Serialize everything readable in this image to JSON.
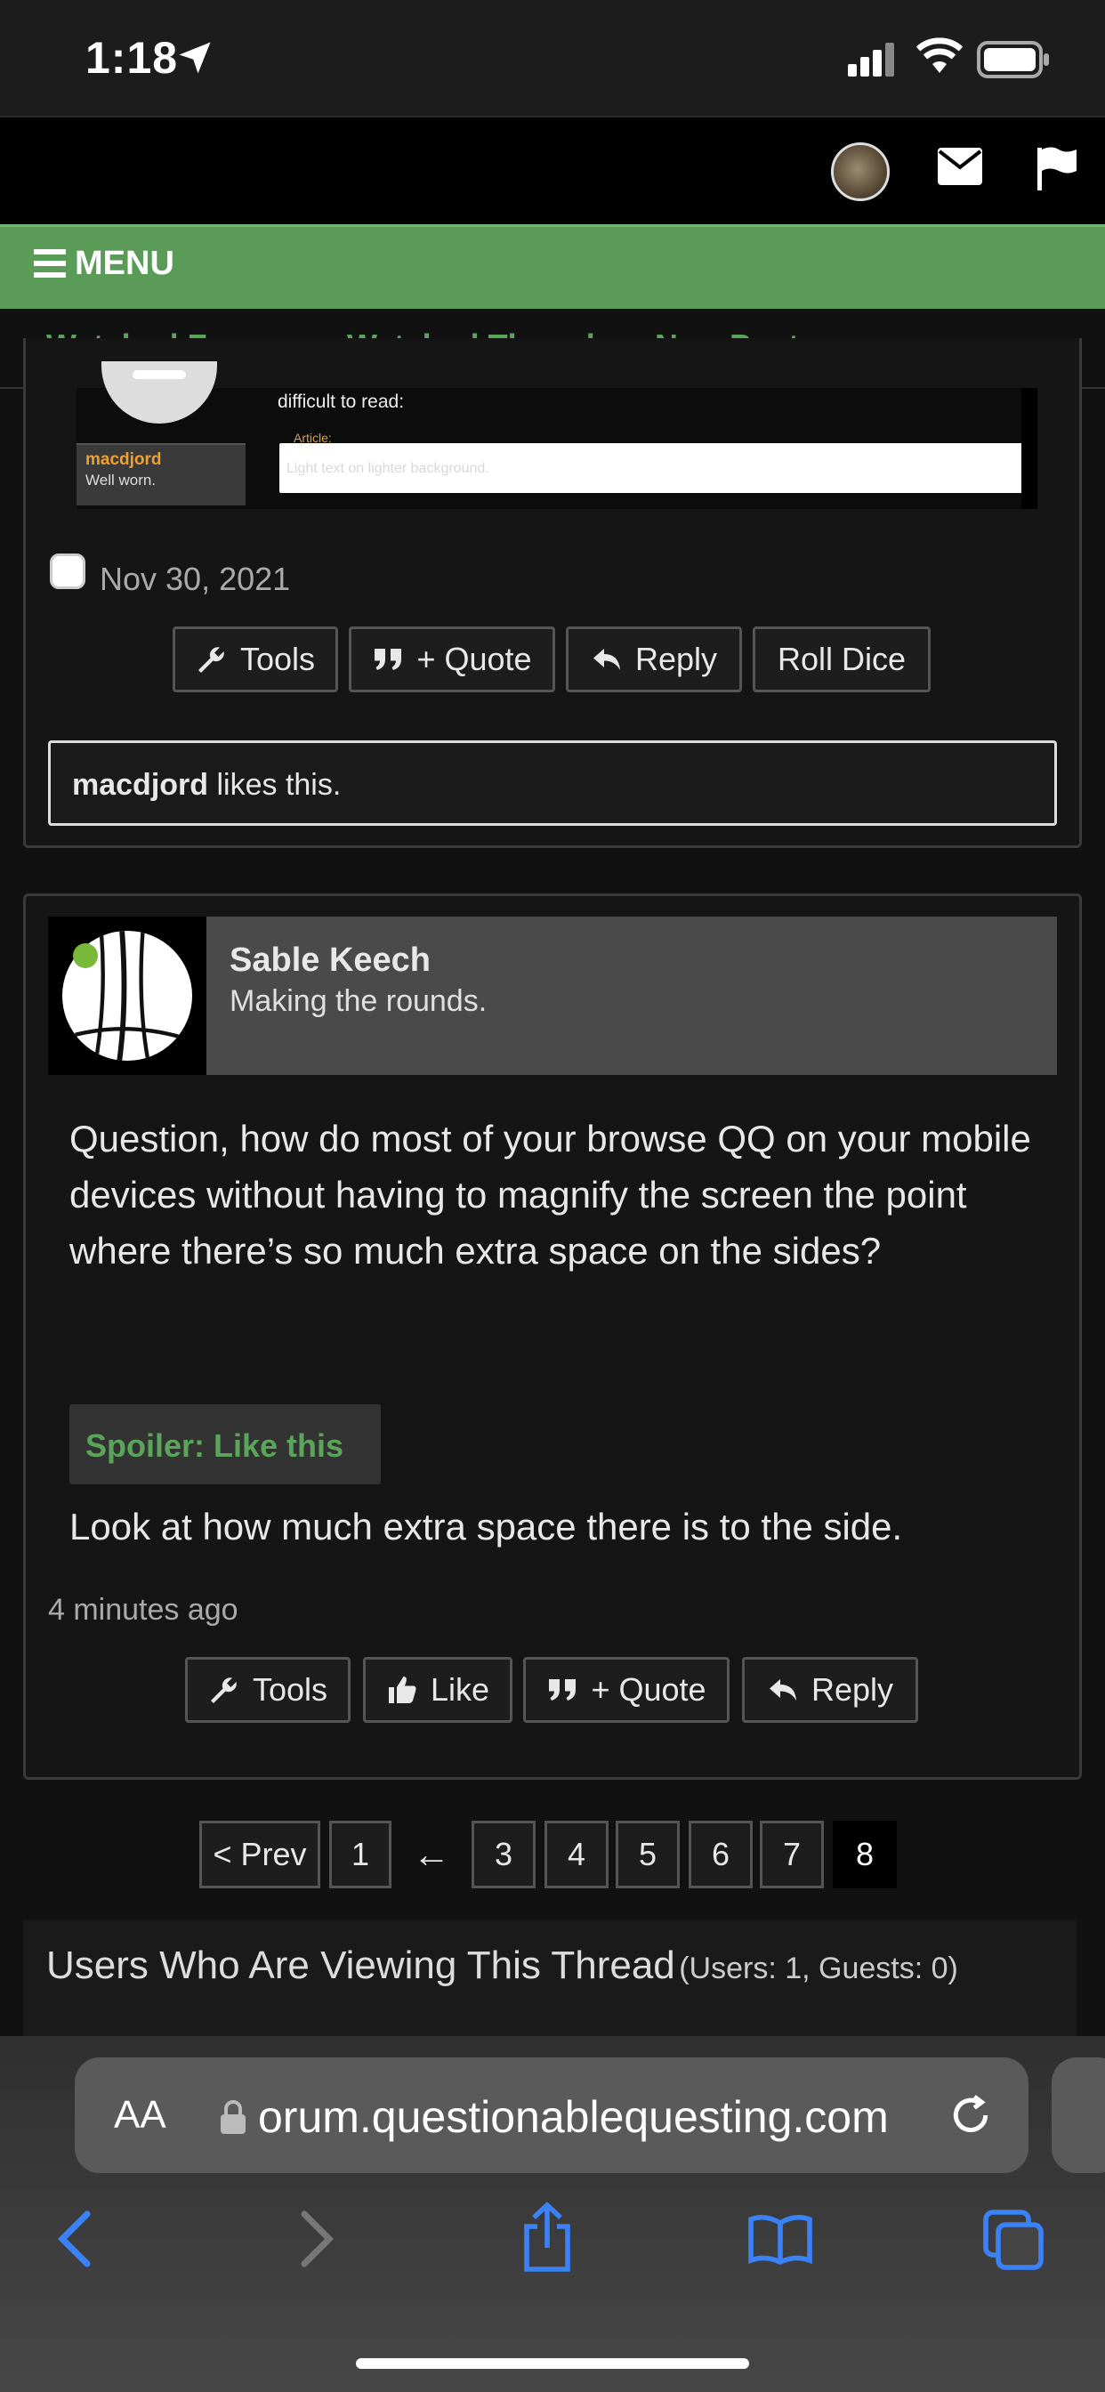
{
  "status_bar": {
    "time": "1:18"
  },
  "menu": {
    "label": "MENU"
  },
  "nav": {
    "links": [
      "Watched Forums",
      "Watched Threads",
      "New Posts",
      "..."
    ]
  },
  "post1": {
    "screenshot": {
      "text": "difficult to read:",
      "quote_label": "Article:",
      "light_text": "Light text on lighter background.",
      "username": "macdjord",
      "user_title": "Well worn."
    },
    "date": "Nov 30, 2021",
    "buttons": {
      "tools": "Tools",
      "quote": "+ Quote",
      "reply": "Reply",
      "roll_dice": "Roll Dice"
    },
    "likes": {
      "user": "macdjord",
      "suffix": " likes this."
    }
  },
  "post2": {
    "username": "Sable Keech",
    "user_title": "Making the rounds.",
    "body": "Question, how do most of your browse QQ on your mobile devices without having to magnify the screen the point where there’s so much extra space on the sides?",
    "spoiler_label": "Spoiler: Like this",
    "after_spoiler": "Look at how much extra space there is to the side.",
    "time": "4 minutes ago",
    "buttons": {
      "tools": "Tools",
      "like": "Like",
      "quote": "+ Quote",
      "reply": "Reply"
    }
  },
  "pagination": {
    "prev": "< Prev",
    "pages": [
      "1",
      "←",
      "3",
      "4",
      "5",
      "6",
      "7",
      "8"
    ],
    "current": "8"
  },
  "viewers": {
    "title": "Users Who Are Viewing This Thread",
    "counts": "(Users: 1, Guests: 0)"
  },
  "safari": {
    "aa": "AA",
    "url": "orum.questionablequesting.com"
  },
  "colors": {
    "accent_green": "#5a9c57",
    "link_green": "#5aa55a",
    "button_blue": "#3b82f6"
  }
}
